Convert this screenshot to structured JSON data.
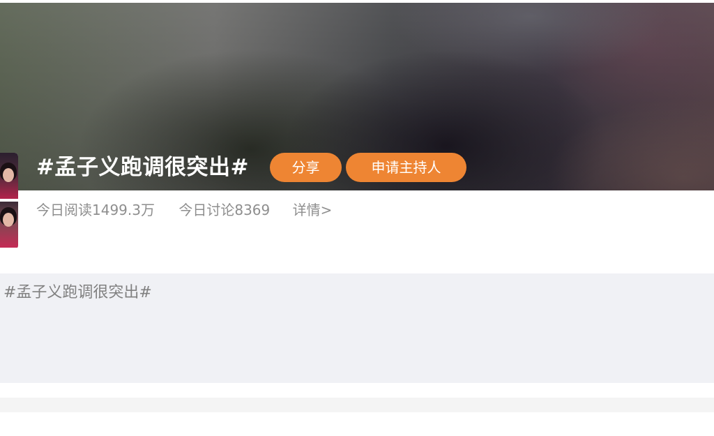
{
  "topic": {
    "title": "#孟子义跑调很突出#",
    "share_label": "分享",
    "apply_host_label": "申请主持人"
  },
  "stats": {
    "reads": "今日阅读1499.3万",
    "discussions": "今日讨论8369",
    "details_label": "详情>"
  },
  "post": {
    "text": "#孟子义跑调很突出#"
  },
  "colors": {
    "accent": "#ee8533",
    "stat_text": "#8e8e8e",
    "post_background": "#f0f1f5"
  },
  "icons": {
    "avatar": "topic-avatar-image"
  }
}
